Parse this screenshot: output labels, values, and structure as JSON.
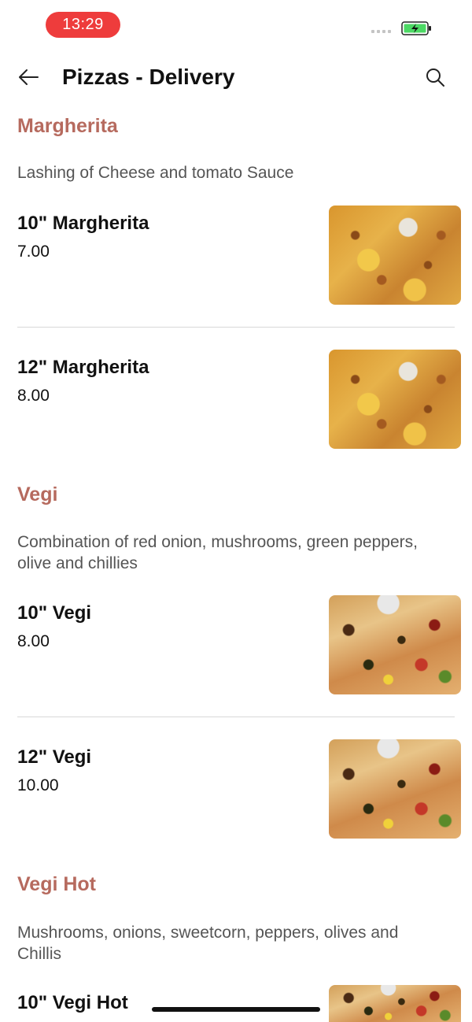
{
  "status": {
    "time": "13:29"
  },
  "header": {
    "title": "Pizzas - Delivery"
  },
  "icons": {
    "back": "arrow-left-icon",
    "search": "search-icon",
    "battery": "battery-charging-icon"
  },
  "colors": {
    "accent": "#b66a5e",
    "time_pill": "#ee3c3c",
    "battery": "#4cd964"
  },
  "sections": [
    {
      "title": "Margherita",
      "description": "Lashing of Cheese and tomato Sauce",
      "items": [
        {
          "name": "10\" Margherita",
          "price": "7.00"
        },
        {
          "name": "12\" Margherita",
          "price": "8.00"
        }
      ]
    },
    {
      "title": "Vegi",
      "description": "Combination of red onion, mushrooms, green peppers, olive and chillies",
      "items": [
        {
          "name": "10\" Vegi",
          "price": "8.00"
        },
        {
          "name": "12\" Vegi",
          "price": "10.00"
        }
      ]
    },
    {
      "title": "Vegi Hot",
      "description": "Mushrooms, onions, sweetcorn, peppers, olives and Chillis",
      "items": [
        {
          "name": "10\" Vegi Hot"
        }
      ]
    }
  ]
}
